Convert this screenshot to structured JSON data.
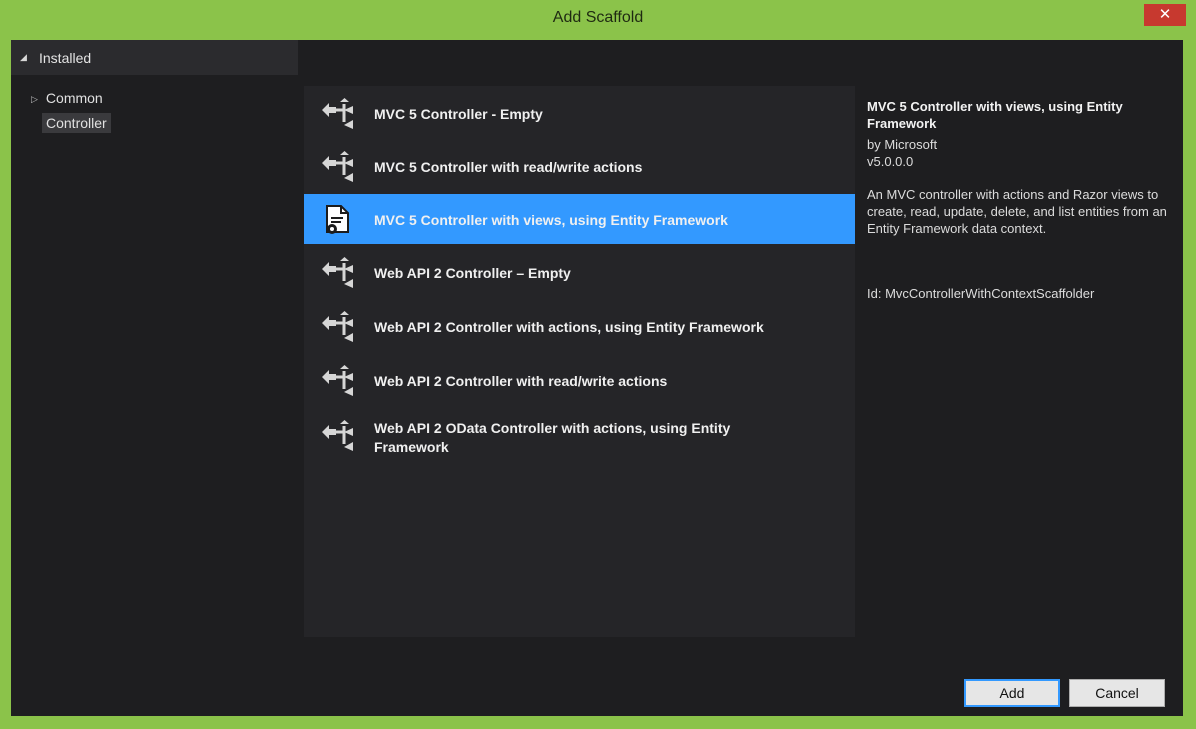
{
  "window": {
    "title": "Add Scaffold",
    "close_label": "✕"
  },
  "sidebar": {
    "header": "Installed",
    "items": [
      {
        "label": "Common",
        "expandable": true
      },
      {
        "label": "Controller",
        "selected": true
      }
    ]
  },
  "scaffolds": {
    "items": [
      {
        "label": "MVC 5 Controller - Empty",
        "icon": "controller-icon"
      },
      {
        "label": "MVC 5 Controller with read/write actions",
        "icon": "controller-icon"
      },
      {
        "label": "MVC 5 Controller with views, using Entity Framework",
        "icon": "views-document-icon",
        "selected": true
      },
      {
        "label": "Web API 2 Controller – Empty",
        "icon": "controller-icon"
      },
      {
        "label": "Web API 2 Controller with actions, using Entity Framework",
        "icon": "controller-icon"
      },
      {
        "label": "Web API 2 Controller with read/write actions",
        "icon": "controller-icon"
      },
      {
        "label": "Web API 2 OData Controller with actions, using Entity Framework",
        "icon": "controller-icon"
      }
    ]
  },
  "details": {
    "title": "MVC 5 Controller with views, using Entity Framework",
    "author": "by Microsoft",
    "version": "v5.0.0.0",
    "description": "An MVC controller with actions and Razor views to create, read, update, delete, and list entities from an Entity Framework data context.",
    "id": "Id: MvcControllerWithContextScaffolder"
  },
  "footer": {
    "add_label": "Add",
    "cancel_label": "Cancel"
  },
  "colors": {
    "frame": "#8bc34a",
    "selection": "#3399ff",
    "close": "#c7392f"
  }
}
